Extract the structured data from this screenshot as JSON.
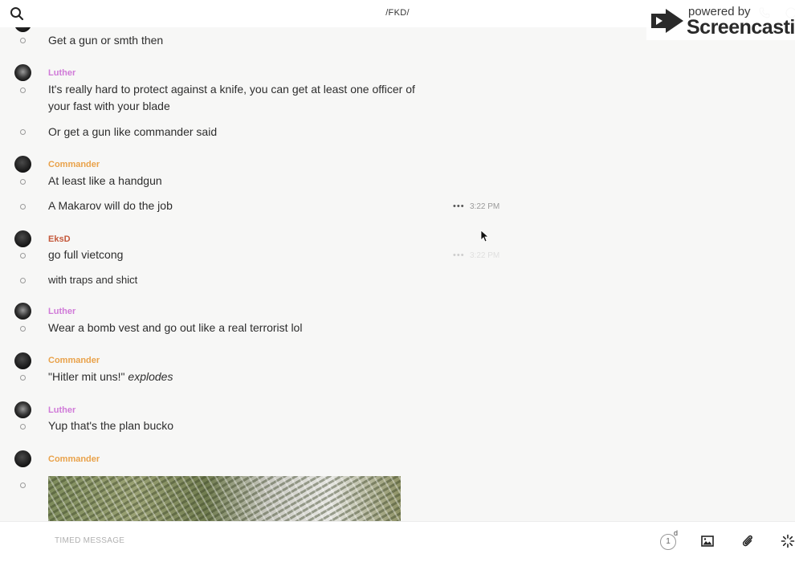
{
  "header": {
    "title": "/FKD/",
    "search_icon": "search-icon",
    "phone_icon": "phone-icon",
    "info_icon": "info-icon"
  },
  "watermark": {
    "small_text": "powered by",
    "brand": "Screencastify"
  },
  "messages": [
    {
      "type": "text",
      "text": "Get a gun or smth then"
    },
    {
      "type": "sender",
      "name": "Luther"
    },
    {
      "type": "text",
      "text": "It's really hard to protect against a knife, you can get at least one officer of your fast with your blade"
    },
    {
      "type": "text",
      "text": "Or get a gun like commander said"
    },
    {
      "type": "sender",
      "name": "Commander"
    },
    {
      "type": "text",
      "text": "At least like a handgun"
    },
    {
      "type": "text",
      "text": "A Makarov will do the job",
      "time": "3:22 PM",
      "actions": "•••"
    },
    {
      "type": "sender",
      "name": "EksD"
    },
    {
      "type": "text",
      "text": "go full vietcong",
      "time": "3:22 PM",
      "actions": "•••"
    },
    {
      "type": "text",
      "text": "with traps and shict"
    },
    {
      "type": "sender",
      "name": "Luther"
    },
    {
      "type": "text",
      "text": "Wear a bomb vest and go out like a real terrorist lol"
    },
    {
      "type": "sender",
      "name": "Commander"
    },
    {
      "type": "text",
      "text_plain": "\"Hitler mit uns!\" ",
      "text_em": "explodes"
    },
    {
      "type": "sender",
      "name": "Luther"
    },
    {
      "type": "text",
      "text": "Yup that's the plan bucko"
    },
    {
      "type": "sender",
      "name": "Commander"
    },
    {
      "type": "image",
      "icon": "image-attachment"
    }
  ],
  "composer": {
    "placeholder": "TIMED MESSAGE",
    "timer_value": "1",
    "timer_unit": "d"
  },
  "colors": {
    "luther": "#d07ad8",
    "commander": "#e9a24a",
    "eksd": "#c4593c",
    "background": "#f7f7f6"
  }
}
